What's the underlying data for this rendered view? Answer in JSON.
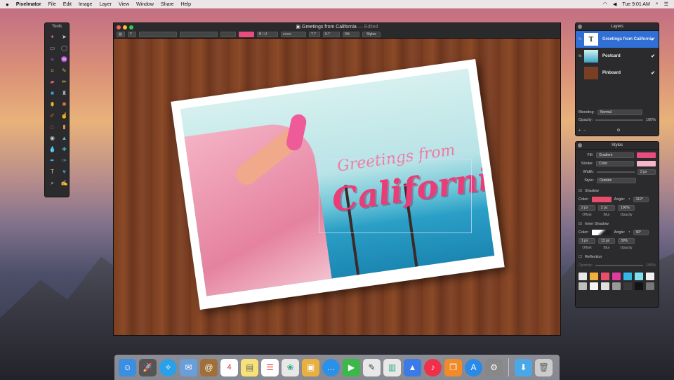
{
  "menubar": {
    "apple": "",
    "app_name": "Pixelmator",
    "items": [
      "File",
      "Edit",
      "Image",
      "Layer",
      "View",
      "Window",
      "Share",
      "Help"
    ],
    "clock": "Tue 9:01 AM"
  },
  "tools_panel": {
    "title": "Tools"
  },
  "window": {
    "title": "Greetings from California",
    "title_suffix": "— Edited",
    "toolbar": {
      "size_value": "0.7",
      "percent_value": "0%",
      "styles_button": "Styles"
    }
  },
  "artwork": {
    "line1": "Greetings from",
    "line2": "California"
  },
  "layers_panel": {
    "title": "Layers",
    "layers": [
      {
        "name": "Greetings from California",
        "thumb": "T",
        "selected": true
      },
      {
        "name": "Postcard",
        "thumb": "",
        "selected": false
      },
      {
        "name": "Pinboard",
        "thumb": "",
        "selected": false
      }
    ],
    "blending_label": "Blending:",
    "blending_value": "Normal",
    "opacity_label": "Opacity:",
    "opacity_value": "100%"
  },
  "styles_panel": {
    "title": "Styles",
    "fill_label": "Fill:",
    "fill_value": "Gradient",
    "stroke_label": "Stroke:",
    "stroke_value": "Color",
    "width_label": "Width:",
    "width_value": "2 px",
    "style_label": "Style:",
    "style_value": "Outside",
    "shadow": {
      "title": "Shadow",
      "color_label": "Color:",
      "angle_label": "Angle:",
      "angle_value": "312°",
      "offset_value": "2 px",
      "blur_value": "2 px",
      "opacity_value": "100%",
      "offset_label": "Offset",
      "blur_label": "Blur",
      "opacity_label": "Opacity"
    },
    "inner_shadow": {
      "title": "Inner Shadow",
      "color_label": "Color:",
      "angle_label": "Angle:",
      "angle_value": "90°",
      "offset_value": "1 px",
      "blur_value": "13 px",
      "opacity_value": "30%",
      "offset_label": "Offset",
      "blur_label": "Blur",
      "opacity_label": "Opacity"
    },
    "reflection": {
      "title": "Reflection",
      "opacity_label": "Opacity:",
      "opacity_value": "100%"
    },
    "preset_colors": [
      "#e8e8e8",
      "#f0b03a",
      "#e94d6b",
      "#e23ba0",
      "#33b8e8",
      "#7de0f0",
      "#f2f2f2",
      "#bfbfbf",
      "#f4f4f4",
      "#e0e0e0",
      "#9a9a9a",
      "#3a3a3a",
      "#141414",
      "#777777"
    ]
  },
  "colors": {
    "accent": "#2f6fd6",
    "pink": "#e84d7d"
  }
}
